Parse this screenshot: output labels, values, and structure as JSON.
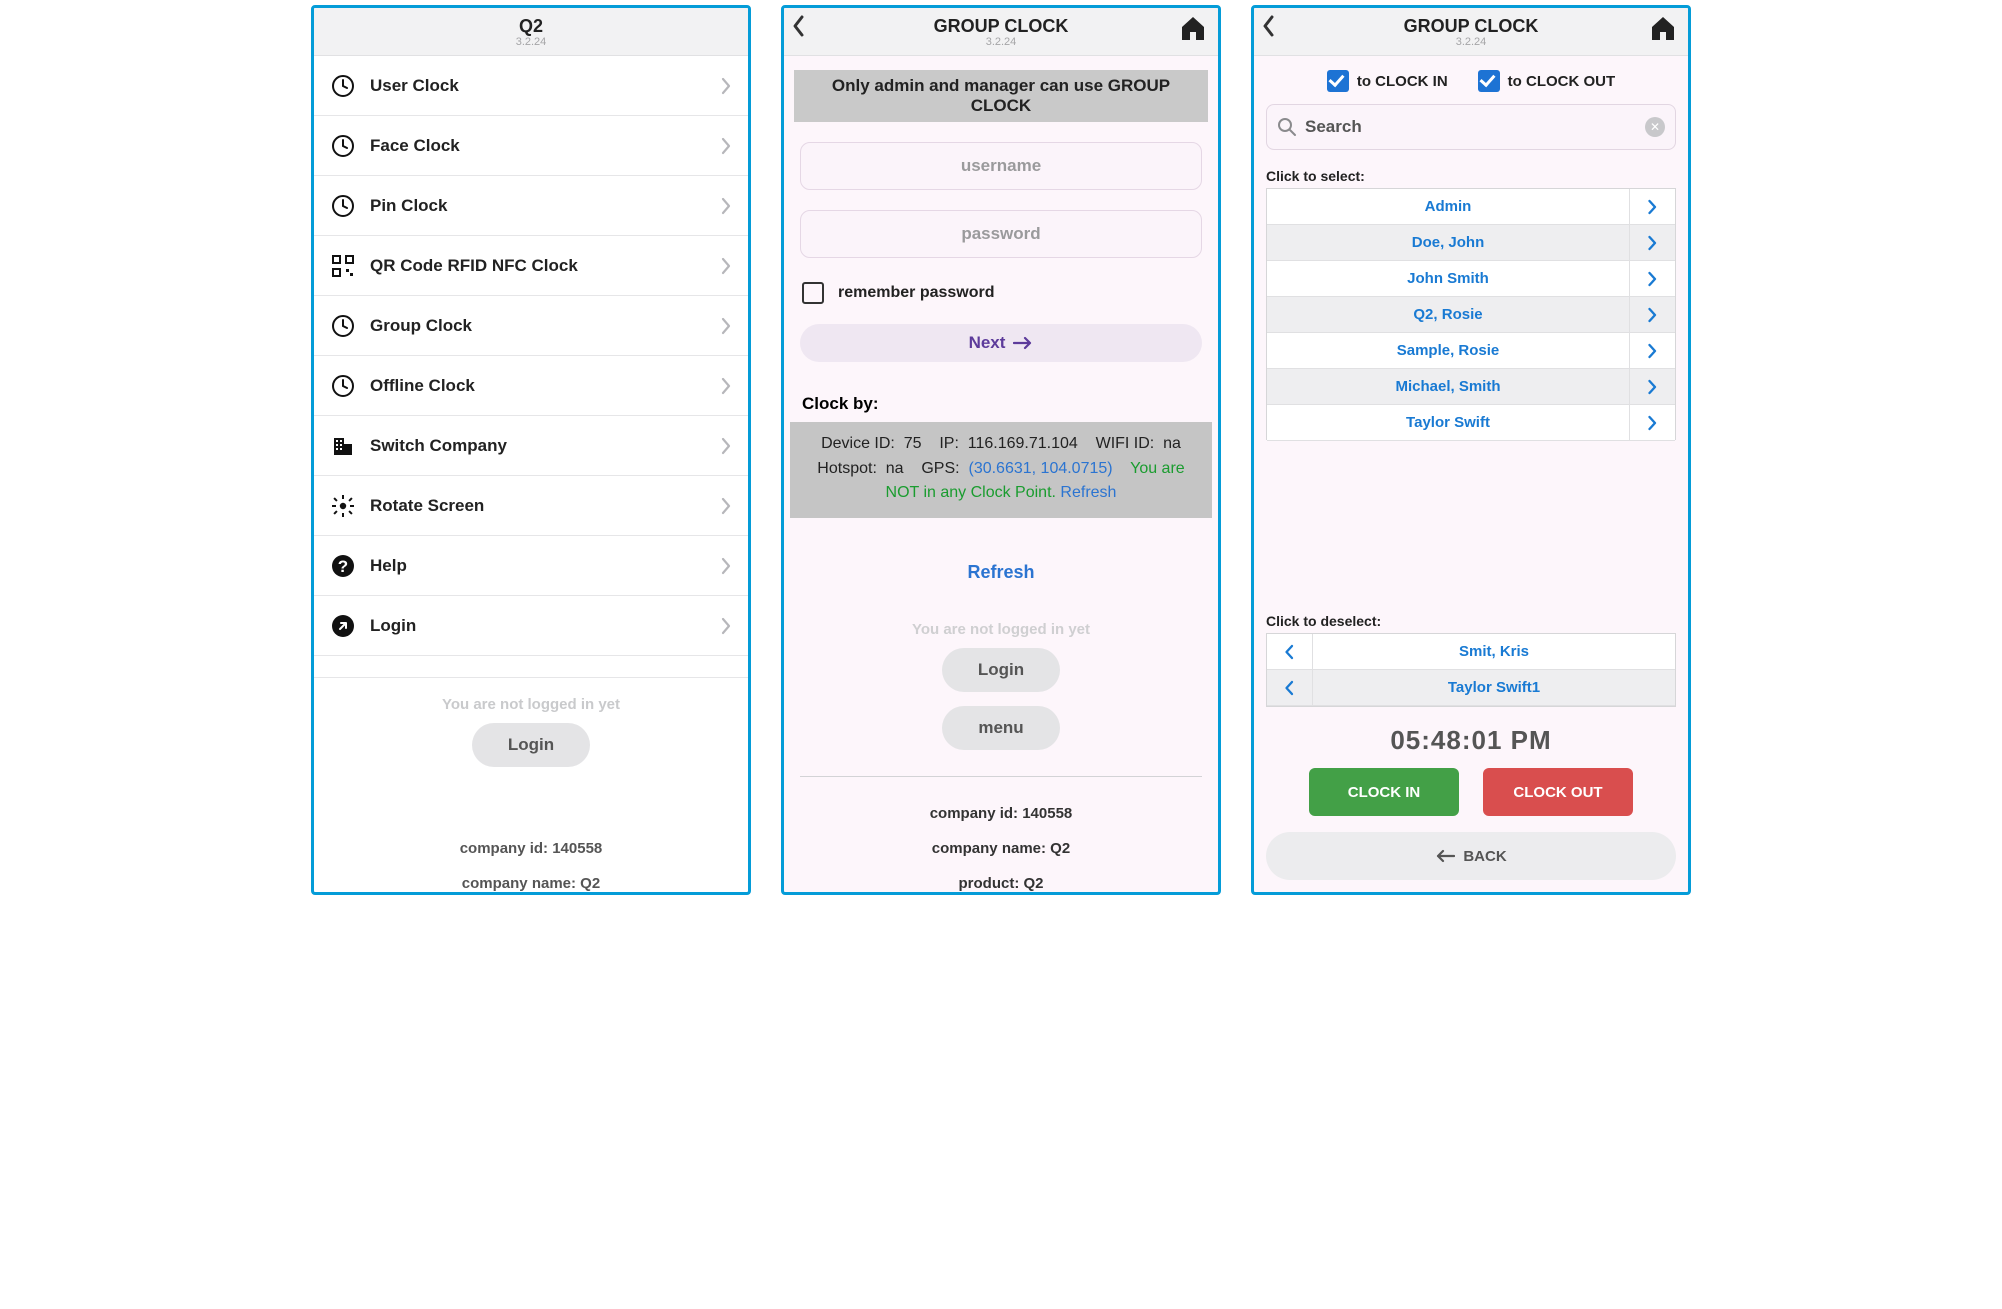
{
  "panel1": {
    "header": {
      "title": "Q2",
      "sub": "3.2.24"
    },
    "menu": [
      {
        "icon": "clock",
        "label": "User Clock"
      },
      {
        "icon": "clock",
        "label": "Face Clock"
      },
      {
        "icon": "clock",
        "label": "Pin Clock"
      },
      {
        "icon": "qr",
        "label": "QR Code RFID NFC Clock"
      },
      {
        "icon": "clock",
        "label": "Group Clock"
      },
      {
        "icon": "clock",
        "label": "Offline Clock"
      },
      {
        "icon": "building",
        "label": "Switch Company"
      },
      {
        "icon": "gear",
        "label": "Rotate Screen"
      },
      {
        "icon": "help",
        "label": "Help"
      },
      {
        "icon": "arrowcircle",
        "label": "Login"
      }
    ],
    "not_logged": "You are not logged in yet",
    "login_btn": "Login",
    "company_id": "company id: 140558",
    "company_name": "company name: Q2"
  },
  "panel2": {
    "header": {
      "title": "GROUP CLOCK",
      "sub": "3.2.24"
    },
    "banner": "Only admin and manager can use GROUP CLOCK",
    "username_ph": "username",
    "password_ph": "password",
    "remember": "remember password",
    "next": "Next",
    "clock_by": "Clock by:",
    "device_id_label": "Device ID:",
    "device_id": "75",
    "ip_label": "IP:",
    "ip": "116.169.71.104",
    "wifi_label": "WIFI ID:",
    "wifi": "na",
    "hotspot_label": "Hotspot:",
    "hotspot": "na",
    "gps_label": "GPS:",
    "gps": "(30.6631, 104.0715)",
    "warn": "You are NOT in any Clock Point.",
    "refresh_link": "Refresh",
    "refresh_big": "Refresh",
    "not_logged": "You are not logged in yet",
    "login_btn": "Login",
    "menu_btn": "menu",
    "company_id": "company id: 140558",
    "company_name": "company name: Q2",
    "product": "product: Q2"
  },
  "panel3": {
    "header": {
      "title": "GROUP CLOCK",
      "sub": "3.2.24"
    },
    "toggle_in": "to CLOCK IN",
    "toggle_out": "to CLOCK OUT",
    "search_ph": "Search",
    "select_label": "Click to select:",
    "select_list": [
      "Admin",
      "Doe, John",
      "John Smith",
      "Q2, Rosie",
      "Sample, Rosie",
      "Michael, Smith",
      "Taylor Swift"
    ],
    "deselect_label": "Click to deselect:",
    "deselect_list": [
      "Smit, Kris",
      "Taylor Swift1"
    ],
    "time": "05:48:01 PM",
    "clock_in": "CLOCK IN",
    "clock_out": "CLOCK OUT",
    "back": "BACK"
  }
}
